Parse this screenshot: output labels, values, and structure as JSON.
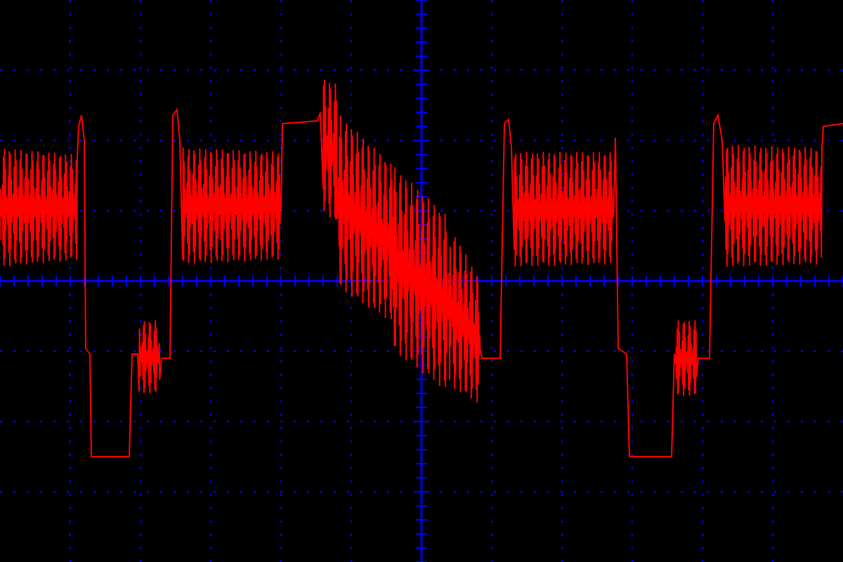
{
  "display": {
    "kind": "oscilloscope"
  }
}
